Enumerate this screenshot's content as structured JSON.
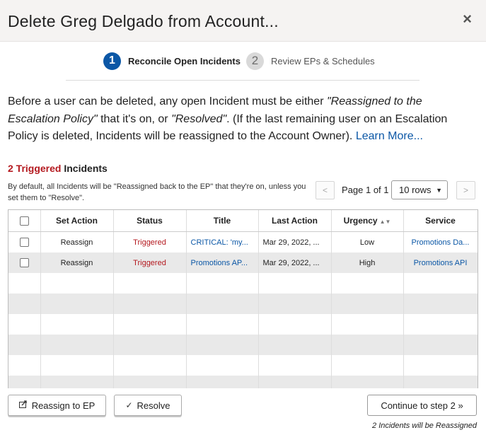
{
  "dialog": {
    "title": "Delete Greg Delgado from Account...",
    "close_symbol": "×"
  },
  "stepper": {
    "steps": [
      {
        "number": "1",
        "label": "Reconcile Open Incidents"
      },
      {
        "number": "2",
        "label": "Review EPs & Schedules"
      }
    ]
  },
  "intro": {
    "part1": "Before a user can be deleted, any open Incident must be either ",
    "q1": "\"Reassigned to the Escalation Policy\"",
    "part2": " that it's on, or ",
    "q2": "\"Resolved\"",
    "part3": ". (If the last remaining user on an Escalation Policy is deleted, Incidents will be reassigned to the Account Owner). ",
    "learn_more": "Learn More..."
  },
  "incidents": {
    "count_label": "2 Triggered",
    "heading_suffix": " Incidents",
    "hint": "By default, all Incidents will be \"Reassigned back to the EP\" that they're on, unless you set them to \"Resolve\"."
  },
  "pager": {
    "prev": "<",
    "next": ">",
    "page_info": "Page 1 of 1",
    "rows_value": "10 rows"
  },
  "table": {
    "columns": [
      "Set Action",
      "Status",
      "Title",
      "Last Action",
      "Urgency",
      "Service"
    ],
    "rows": [
      {
        "action": "Reassign",
        "status": "Triggered",
        "title": "CRITICAL: 'my...",
        "last_action": "Mar 29, 2022, ...",
        "urgency": "Low",
        "service": "Promotions Da..."
      },
      {
        "action": "Reassign",
        "status": "Triggered",
        "title": "Promotions AP...",
        "last_action": "Mar 29, 2022, ...",
        "urgency": "High",
        "service": "Promotions API"
      }
    ]
  },
  "footer": {
    "reassign_label": "Reassign to EP",
    "resolve_label": "Resolve",
    "continue_label": "Continue to step 2 »",
    "note": "2 Incidents will be Reassigned"
  }
}
